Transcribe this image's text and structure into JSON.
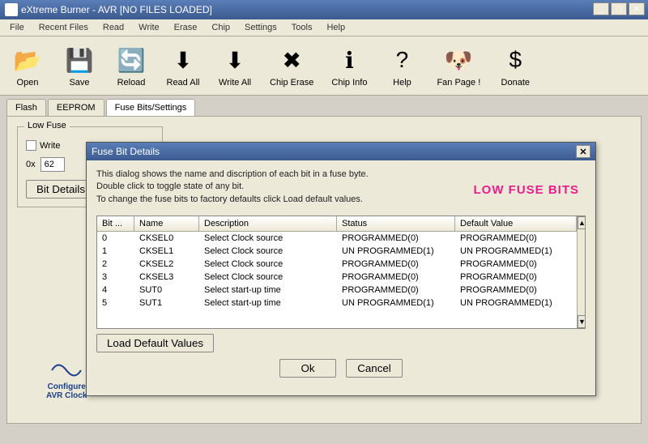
{
  "window": {
    "title": "eXtreme Burner - AVR [NO FILES LOADED]"
  },
  "menus": [
    "File",
    "Recent Files",
    "Read",
    "Write",
    "Erase",
    "Chip",
    "Settings",
    "Tools",
    "Help"
  ],
  "toolbar": [
    {
      "label": "Open",
      "icon": "📂"
    },
    {
      "label": "Save",
      "icon": "💾"
    },
    {
      "label": "Reload",
      "icon": "🔄"
    },
    {
      "label": "Read All",
      "icon": "⬇"
    },
    {
      "label": "Write All",
      "icon": "⬇"
    },
    {
      "label": "Chip Erase",
      "icon": "✖"
    },
    {
      "label": "Chip Info",
      "icon": "ℹ"
    },
    {
      "label": "Help",
      "icon": "?"
    },
    {
      "label": "Fan Page !",
      "icon": "🐶"
    },
    {
      "label": "Donate",
      "icon": "$"
    }
  ],
  "tabs": [
    "Flash",
    "EEPROM",
    "Fuse Bits/Settings"
  ],
  "lowFuse": {
    "groupLabel": "Low Fuse",
    "writeLabel": "Write",
    "hexPrefix": "0x",
    "hexValue": "62",
    "bitDetailsBtn": "Bit Details"
  },
  "avrClock": {
    "line1": "Configure",
    "line2": "AVR Clock"
  },
  "dialog": {
    "title": "Fuse Bit Details",
    "intro1": "This dialog shows the name and discription of each bit in a fuse byte.",
    "intro2": "Double click to toggle state of any bit.",
    "intro3": "To change the fuse bits to factory defaults click Load default values.",
    "pinkLabel": "LOW FUSE BITS",
    "columns": [
      "Bit ...",
      "Name",
      "Description",
      "Status",
      "Default Value"
    ],
    "rows": [
      {
        "bit": "0",
        "name": "CKSEL0",
        "desc": "Select Clock source",
        "status": "PROGRAMMED(0)",
        "def": "PROGRAMMED(0)"
      },
      {
        "bit": "1",
        "name": "CKSEL1",
        "desc": "Select Clock source",
        "status": "UN PROGRAMMED(1)",
        "def": "UN PROGRAMMED(1)"
      },
      {
        "bit": "2",
        "name": "CKSEL2",
        "desc": "Select Clock source",
        "status": "PROGRAMMED(0)",
        "def": "PROGRAMMED(0)"
      },
      {
        "bit": "3",
        "name": "CKSEL3",
        "desc": "Select Clock source",
        "status": "PROGRAMMED(0)",
        "def": "PROGRAMMED(0)"
      },
      {
        "bit": "4",
        "name": "SUT0",
        "desc": "Select start-up time",
        "status": "PROGRAMMED(0)",
        "def": "PROGRAMMED(0)"
      },
      {
        "bit": "5",
        "name": "SUT1",
        "desc": "Select start-up time",
        "status": "UN PROGRAMMED(1)",
        "def": "UN PROGRAMMED(1)"
      }
    ],
    "loadDefaults": "Load Default Values",
    "ok": "Ok",
    "cancel": "Cancel"
  }
}
